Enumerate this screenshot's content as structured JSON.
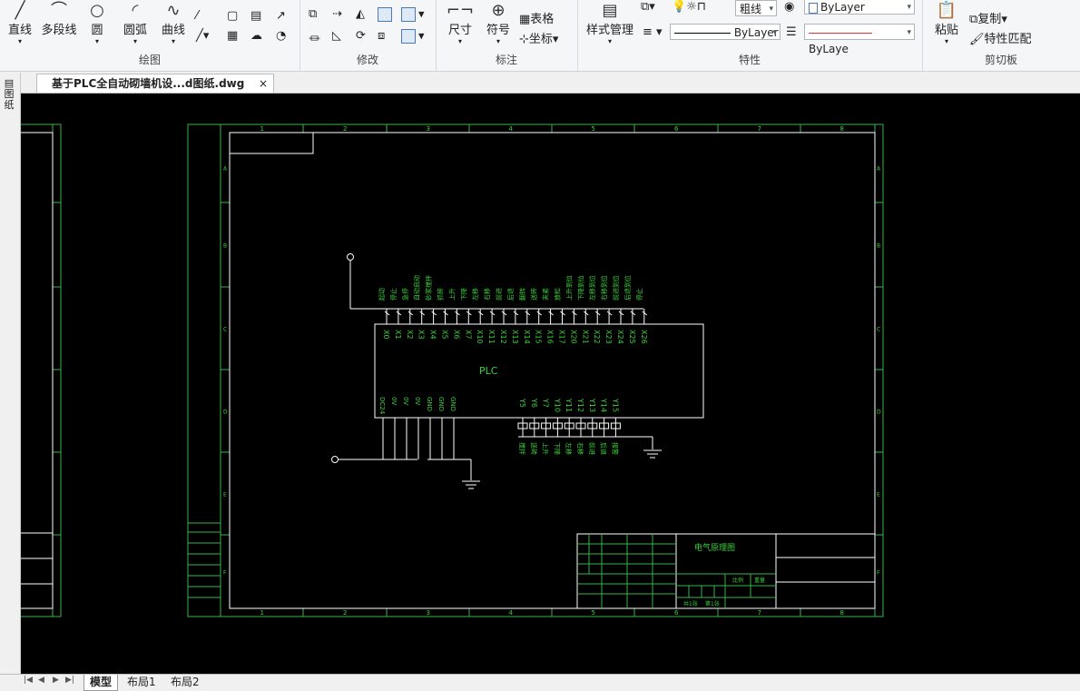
{
  "ribbon": {
    "draw": {
      "label": "绘图",
      "line": "直线",
      "polyline": "多段线",
      "circle": "圆",
      "arc": "圆弧",
      "curve": "曲线"
    },
    "modify": {
      "label": "修改"
    },
    "annotate": {
      "label": "标注",
      "dimension": "尺寸",
      "symbol": "符号",
      "table": "表格",
      "coordinate": "坐标"
    },
    "properties": {
      "label": "特性",
      "style_manager": "样式管理",
      "bylayer_color": "ByLayer",
      "bylayer_linetype": "ByLayer",
      "bylayer_lineweight": "ByLaye",
      "thickness": "粗线"
    },
    "clipboard": {
      "label": "剪切板",
      "paste": "粘贴",
      "copy": "复制",
      "match": "特性匹配"
    }
  },
  "document_tab": {
    "title": "基于PLC全自动砌墙机设...d图纸.dwg",
    "close": "×"
  },
  "left_toolbar": {
    "label": "图纸"
  },
  "drawing": {
    "border_numbers": [
      "1",
      "2",
      "3",
      "4",
      "5",
      "6",
      "7",
      "8"
    ],
    "border_letters": [
      "A",
      "B",
      "C",
      "D",
      "E",
      "F"
    ],
    "plc_label": "PLC",
    "inputs": [
      "X0",
      "X1",
      "X2",
      "X3",
      "X4",
      "X5",
      "X6",
      "X7",
      "X10",
      "X11",
      "X12",
      "X13",
      "X14",
      "X15",
      "X16",
      "X17",
      "X20",
      "X21",
      "X22",
      "X23",
      "X24",
      "X25",
      "X26"
    ],
    "input_descriptions": [
      "起动",
      "停止",
      "急停",
      "自动启动",
      "砂浆搅拌",
      "抓砖",
      "上升",
      "下降",
      "左移",
      "右移",
      "前进",
      "后退",
      "翻转",
      "送砖",
      "夹紧",
      "放松",
      "上升到位",
      "下降到位",
      "左移到位",
      "右移到位",
      "前进到位",
      "后退到位",
      "停止"
    ],
    "power_terminals": [
      "DC24",
      "0V",
      "0V",
      "0V",
      "GND",
      "GND",
      "GND"
    ],
    "outputs": [
      "Y5",
      "Y6",
      "Y7",
      "Y10",
      "Y11",
      "Y12",
      "Y13",
      "Y14",
      "Y15"
    ],
    "output_descriptions": [
      "搅拌",
      "送砖",
      "上升",
      "下降",
      "左移",
      "右移",
      "前进",
      "后退",
      "报警"
    ],
    "title_block_name": "电气原理图",
    "title_block_sub": [
      "比例",
      "重量",
      "共1张",
      "第1张"
    ]
  },
  "layout_tabs": {
    "model": "模型",
    "layout1": "布局1",
    "layout2": "布局2"
  },
  "colors": {
    "canvas_bg": "#000000",
    "frame_green": "#39b54a",
    "drawing_white": "#ffffff",
    "text_green": "#3cd23c",
    "bylayer_red": "#e03030"
  }
}
